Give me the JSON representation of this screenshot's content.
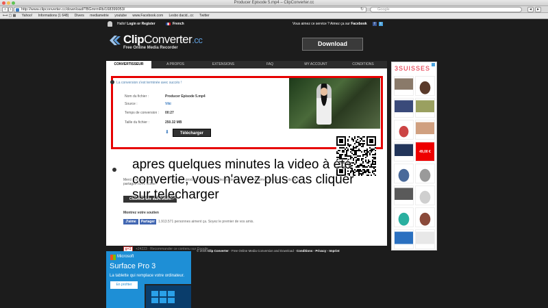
{
  "window": {
    "title": "Producer Episode 5.mp4 – ClipConverter.cc"
  },
  "browser": {
    "url": "http://www.clipconverter.cc/download/TBGmrmRb/168399053/",
    "search_placeholder": "Google",
    "bookmarks": [
      "Yahoo!",
      "Informations (1 648)",
      "Divers",
      "mediametrie",
      "youtube",
      "www.Facebook.com",
      "Lesbo dacid...cc",
      "Twitter"
    ]
  },
  "site": {
    "hello": "Hallo!",
    "login": "Login or Register",
    "language": "French",
    "like_text": "Vous aimez ce service ? Aimez ça sur",
    "like_brand": "Facebook",
    "brand_clip": "Clip",
    "brand_converter": "Converter",
    "brand_cc": ".cc",
    "tagline": "Free Online Media Recorder",
    "download_button": "Download"
  },
  "nav": {
    "tabs": [
      "CONVERTISSEUR",
      "A PROPOS",
      "EXTENSIONS",
      "FAQ",
      "MY ACCOUNT",
      "CONDITIONS"
    ]
  },
  "result": {
    "success": "La conversion s'est terminée avec succès !",
    "rows": [
      {
        "label": "Nom du fichier :",
        "value": "Producer Episode 5.mp4"
      },
      {
        "label": "Source :",
        "value": "Viki"
      },
      {
        "label": "Temps de conversion :",
        "value": "00:27"
      },
      {
        "label": "Taille du fichier :",
        "value": "250.32 MB"
      }
    ],
    "button": "Télécharger"
  },
  "lower": {
    "text": "Merci d'utiliser notre service ! Pour notre produit, si vous souhaitez soutenir notre travail, aimez-nous sur facebook ou partagez notre fichier.",
    "button": "Convertir une autre vidéo",
    "more": "Montrez votre soutien",
    "fb_like": "J'aime",
    "fb_share": "Partager",
    "fb_count": "1.913.571 personnes aiment ça. Soyez le premier de vos amis.",
    "gplus": "g+1",
    "gplus_text": "+24223 · Recommander ce contenu sur Google"
  },
  "overlay_text": "apres quelques minutes la video à été convertie, vous n'avez plus cas cliquer sur telecharger",
  "footer": {
    "copyright": "© 2015",
    "brand": "Clip Converter",
    "text": " - Free Online Media Conversion and Download - ",
    "links": "Conditions - Privacy - Imprint"
  },
  "ads": {
    "side_brand": "SUISSES",
    "side_price": "49,00 €",
    "ms_brand": "Microsoft",
    "ms_title": "Surface Pro 3",
    "ms_tagline": "La tablette qui remplace votre ordinateur.",
    "ms_cta": "En profiter"
  },
  "colors": {
    "accent": "#e60000",
    "facebook": "#3b5998",
    "link": "#3b7bbf"
  }
}
